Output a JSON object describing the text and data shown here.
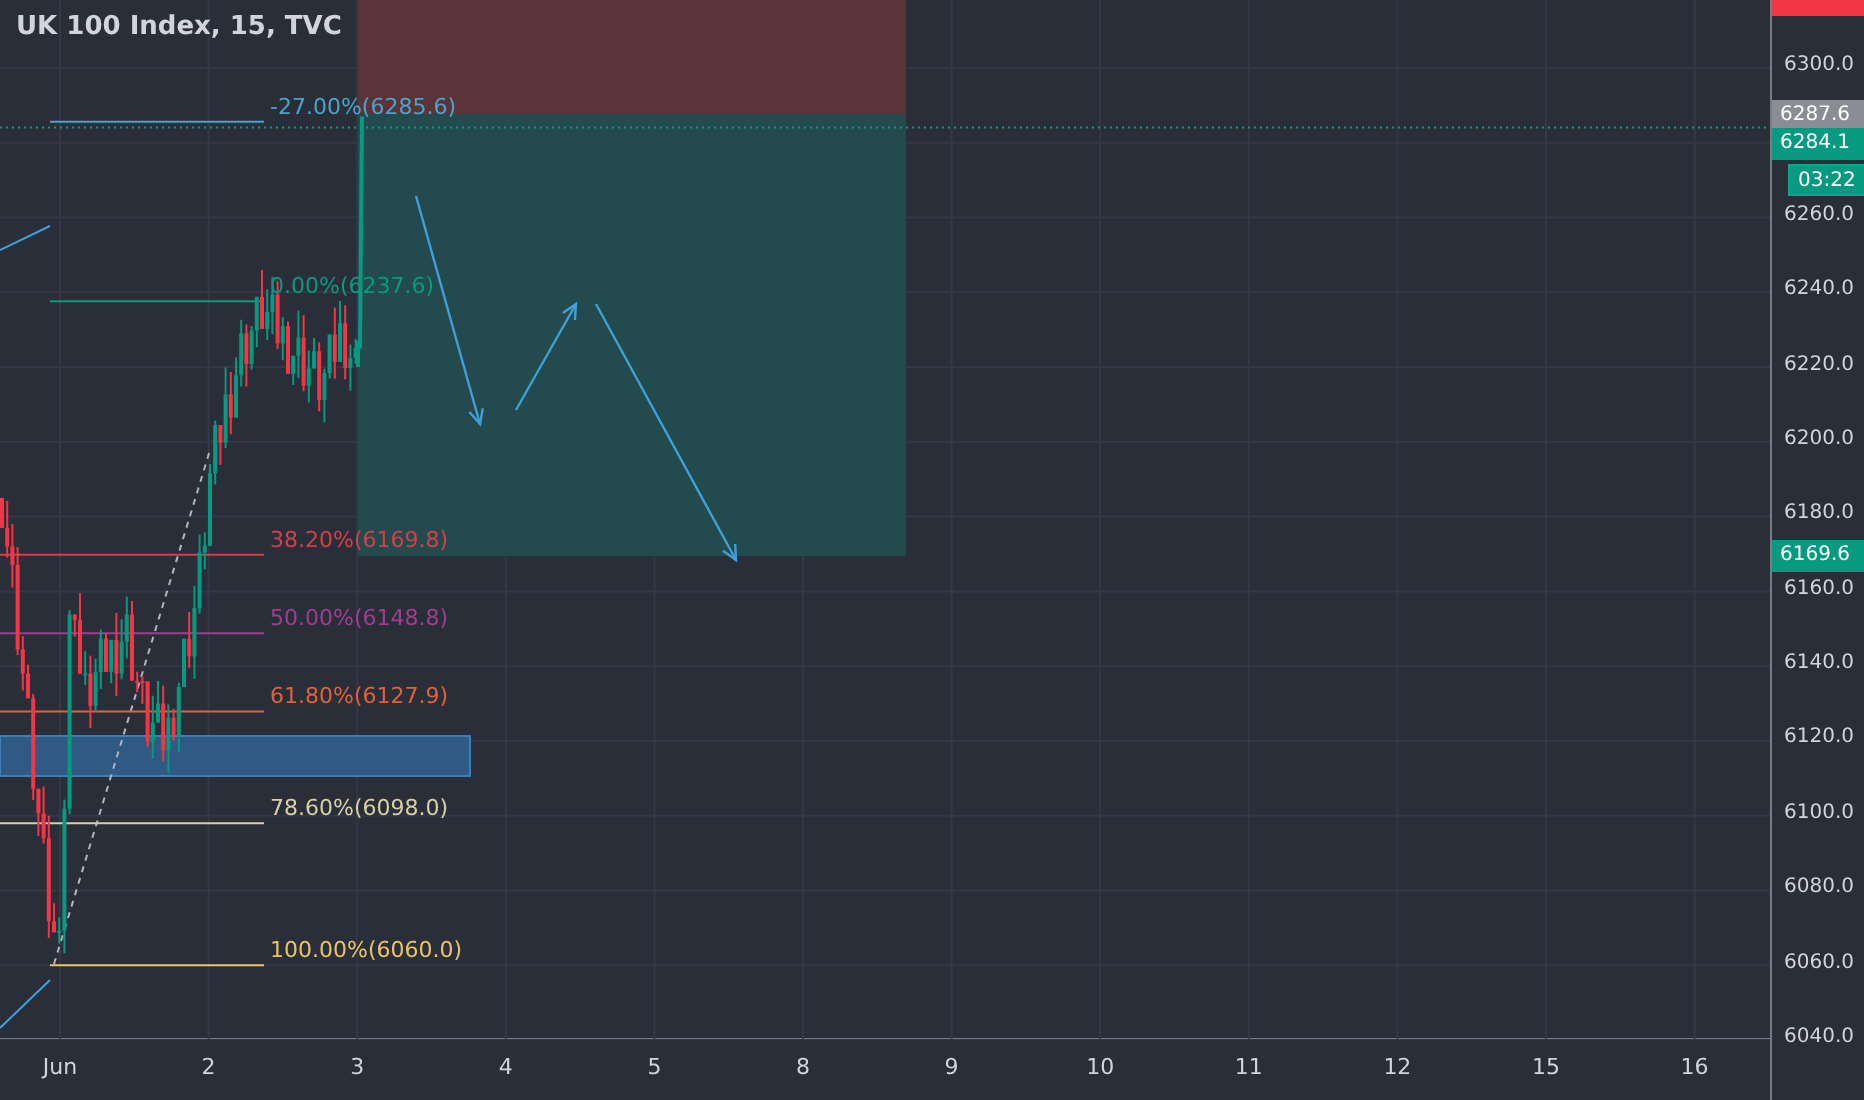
{
  "title": "UK 100 Index, 15, TVC",
  "price_axis": [
    "6300.0",
    "6260.0",
    "6240.0",
    "6220.0",
    "6200.0",
    "6180.0",
    "6160.0",
    "6140.0",
    "6120.0",
    "6100.0",
    "6080.0",
    "6060.0",
    "6040.0"
  ],
  "price_tags": [
    {
      "kind": "marker",
      "text": "6287.6"
    },
    {
      "kind": "last",
      "text": "6284.1"
    },
    {
      "kind": "countdown",
      "text": "03:22"
    },
    {
      "kind": "last",
      "text": "6169.6"
    }
  ],
  "time_axis": [
    "Jun",
    "2",
    "3",
    "4",
    "5",
    "8",
    "9",
    "10",
    "11",
    "12",
    "15",
    "16"
  ],
  "fib_levels": [
    {
      "label": "-27.00%(6285.6)",
      "color": "#4aa3c8"
    },
    {
      "label": "0.00%(6237.6)",
      "color": "#089981"
    },
    {
      "label": "38.20%(6169.8)",
      "color": "#d2404b"
    },
    {
      "label": "50.00%(6148.8)",
      "color": "#9c3f8f"
    },
    {
      "label": "61.80%(6127.9)",
      "color": "#e0623a"
    },
    {
      "label": "78.60%(6098.0)",
      "color": "#d8cfa4"
    },
    {
      "label": "100.00%(6060.0)",
      "color": "#e8c36a"
    }
  ]
}
